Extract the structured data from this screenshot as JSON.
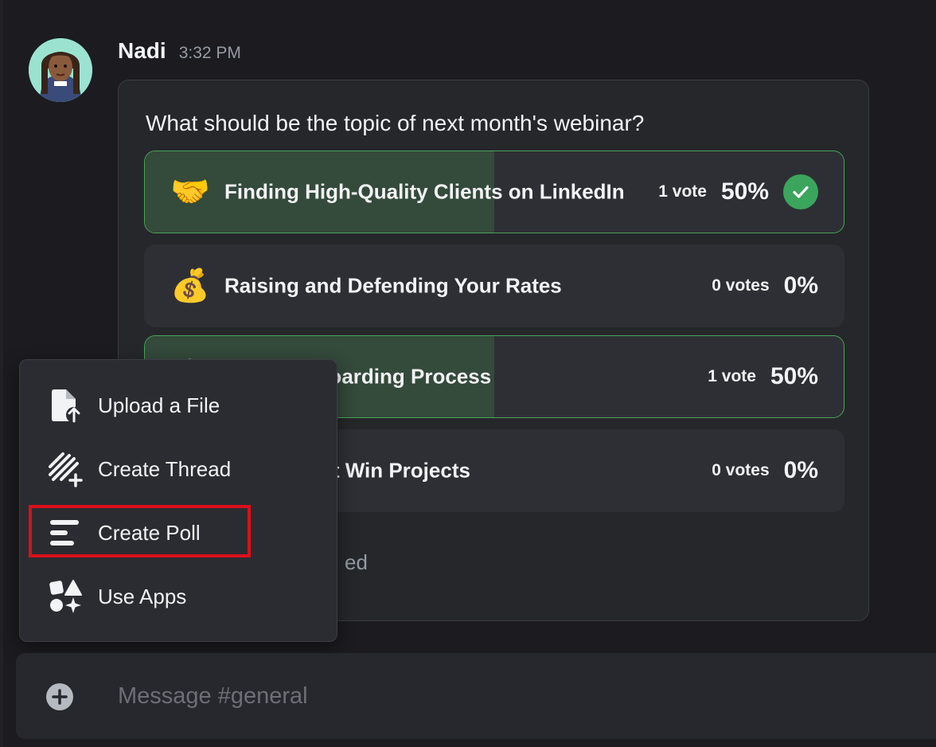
{
  "message": {
    "author": "Nadi",
    "timestamp": "3:32 PM"
  },
  "poll": {
    "question": "What should be the topic of next month's webinar?",
    "options": [
      {
        "emoji": "🤝",
        "label": "Finding High-Quality Clients on LinkedIn",
        "votes": "1 vote",
        "percent": "50%",
        "fill": 0.5,
        "selected": true,
        "voted_by_me": true
      },
      {
        "emoji": "💰",
        "label": "Raising and Defending Your Rates",
        "votes": "0 votes",
        "percent": "0%",
        "fill": 0,
        "selected": false
      },
      {
        "emoji": "📋",
        "label": "Client Onboarding Process",
        "votes": "1 vote",
        "percent": "50%",
        "fill": 0.5,
        "selected": true
      },
      {
        "emoji": "📝",
        "label": "posals That Win Projects",
        "votes": "0 votes",
        "percent": "0%",
        "fill": 0,
        "selected": false
      }
    ],
    "footer_visible_fragment": "ed"
  },
  "attach_menu": {
    "items": [
      {
        "label": "Upload a File",
        "icon": "upload-file-icon"
      },
      {
        "label": "Create Thread",
        "icon": "create-thread-icon"
      },
      {
        "label": "Create Poll",
        "icon": "poll-icon",
        "highlighted": true
      },
      {
        "label": "Use Apps",
        "icon": "apps-icon"
      }
    ],
    "highlight_color": "#d9101c"
  },
  "composer": {
    "placeholder": "Message #general",
    "icon": "plus-circle-icon"
  },
  "colors": {
    "background": "#1c1c20",
    "card": "#26272b",
    "selected_border": "#4aa35a",
    "vote_fill": "#344a3b",
    "check": "#3ba55d"
  }
}
